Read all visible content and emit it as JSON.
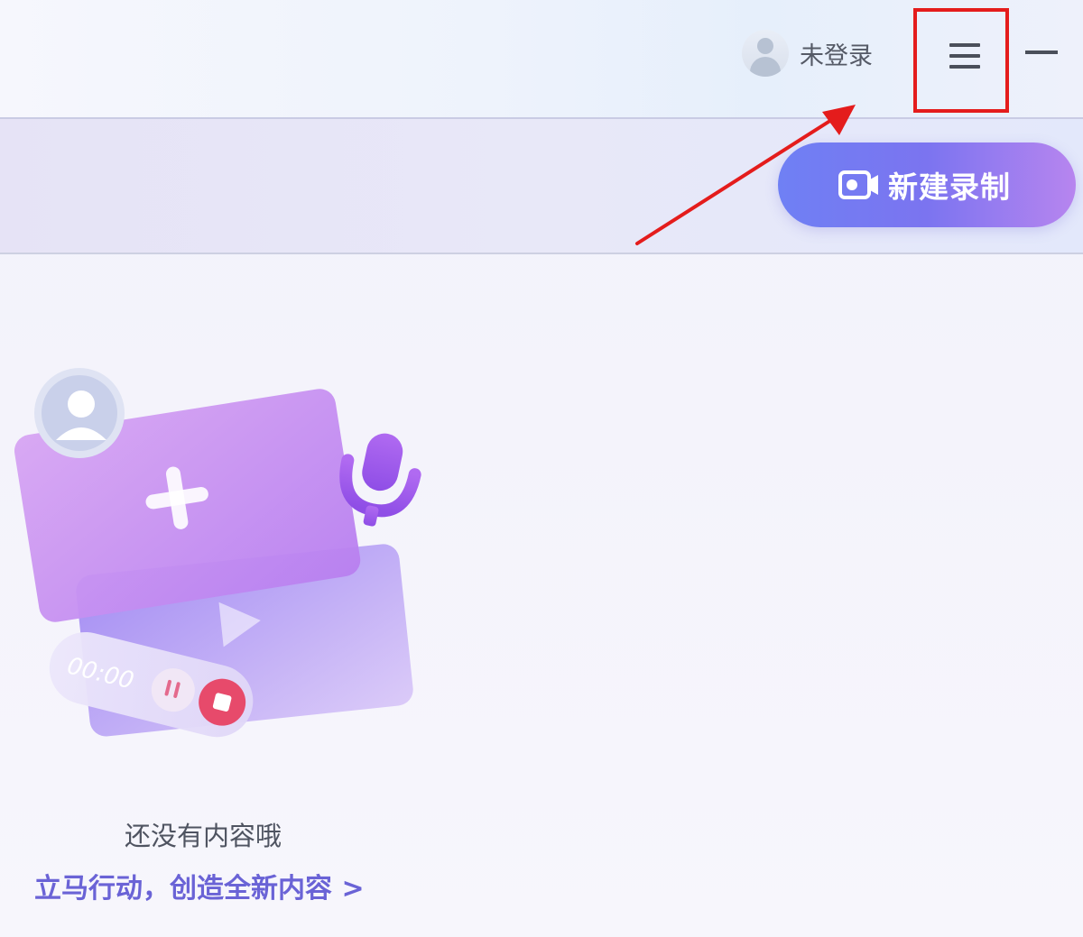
{
  "header": {
    "login_status": "未登录",
    "icons": [
      "avatar-icon",
      "menu-icon",
      "minimize-icon"
    ]
  },
  "toolbar": {
    "new_record_label": "新建录制",
    "record_icon": "video-record-icon"
  },
  "empty_state": {
    "message": "还没有内容哦",
    "cta": "立马行动，创造全新内容 >",
    "timer_text": "00:00"
  },
  "colors": {
    "accent": "#6f80f4",
    "accent_end": "#b785ef",
    "link": "#6a63d6",
    "annotation": "#e41c1c"
  }
}
